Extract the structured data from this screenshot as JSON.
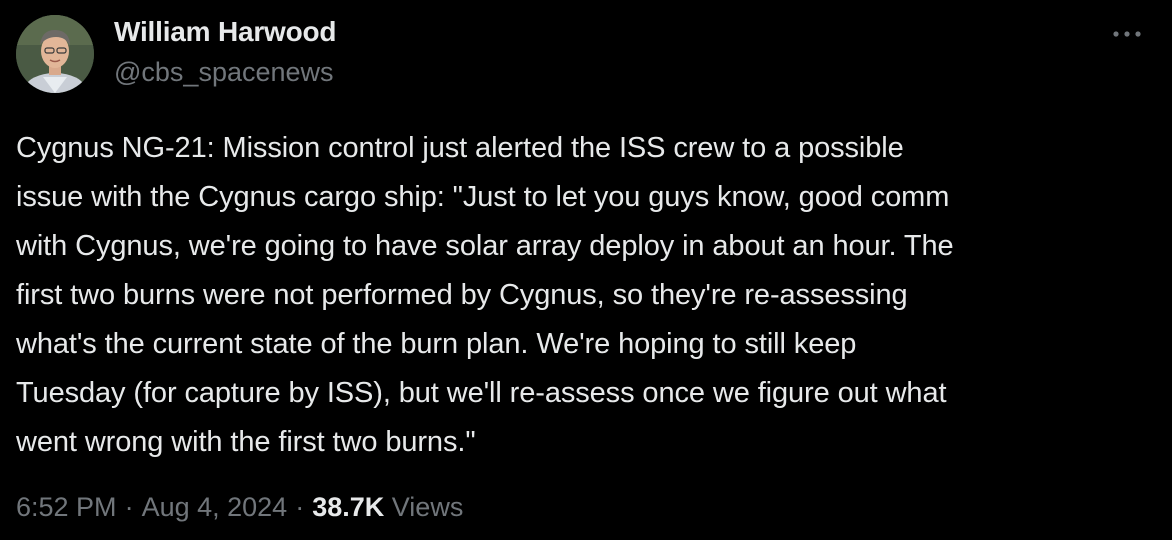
{
  "author": {
    "display_name": "William Harwood",
    "handle": "@cbs_spacenews",
    "avatar_icon": "profile-photo"
  },
  "more_icon": "more-horizontal-icon",
  "tweet": {
    "lines": [
      "Cygnus NG-21: Mission control just alerted the ISS crew to a possible",
      "issue with the Cygnus cargo ship: \"Just to let you guys know, good comm",
      "with Cygnus, we're going to have solar array deploy in about an hour. The",
      "first two burns were not performed by Cygnus, so they're re-assessing",
      "what's the current state of the burn plan. We're hoping to still keep",
      "Tuesday (for capture by ISS), but we'll re-assess once we figure out what",
      "went wrong with the first two burns.\""
    ]
  },
  "meta": {
    "time": "6:52 PM",
    "separator": "·",
    "date": "Aug 4, 2024",
    "views_count": "38.7K",
    "views_label": "Views"
  },
  "colors": {
    "background": "#000000",
    "primary_text": "#e7e9ea",
    "secondary_text": "#71767b"
  }
}
